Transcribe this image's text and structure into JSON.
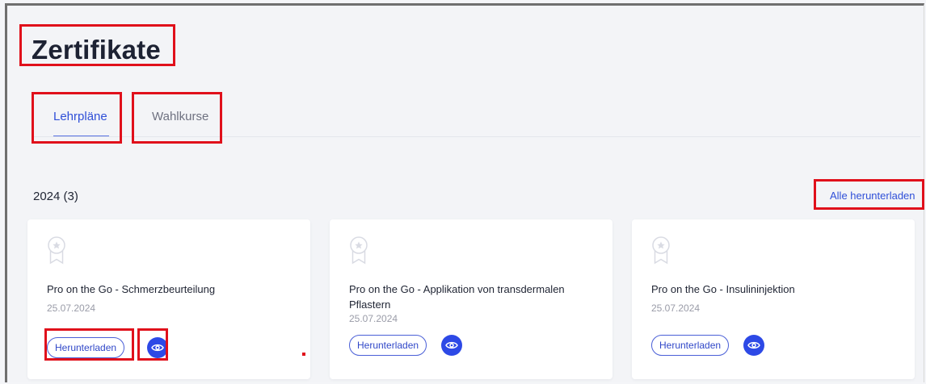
{
  "page": {
    "title": "Zertifikate"
  },
  "tabs": [
    {
      "label": "Lehrpläne",
      "active": true
    },
    {
      "label": "Wahlkurse",
      "active": false
    }
  ],
  "section": {
    "year_label": "2024 (3)",
    "download_all_label": "Alle herunterladen"
  },
  "certificates": [
    {
      "title": "Pro on the Go - Schmerzbeurteilung",
      "date": "25.07.2024",
      "download_label": "Herunterladen"
    },
    {
      "title": "Pro on the Go - Applikation von transdermalen Pflastern",
      "date": "25.07.2024",
      "download_label": "Herunterladen"
    },
    {
      "title": "Pro on the Go - Insulininjektion",
      "date": "25.07.2024",
      "download_label": "Herunterladen"
    }
  ],
  "icons": {
    "certificate_badge": "award-icon",
    "view": "eye-icon"
  },
  "colors": {
    "accent": "#2d49e6",
    "highlight": "#e0101b",
    "background": "#f3f4f7"
  }
}
